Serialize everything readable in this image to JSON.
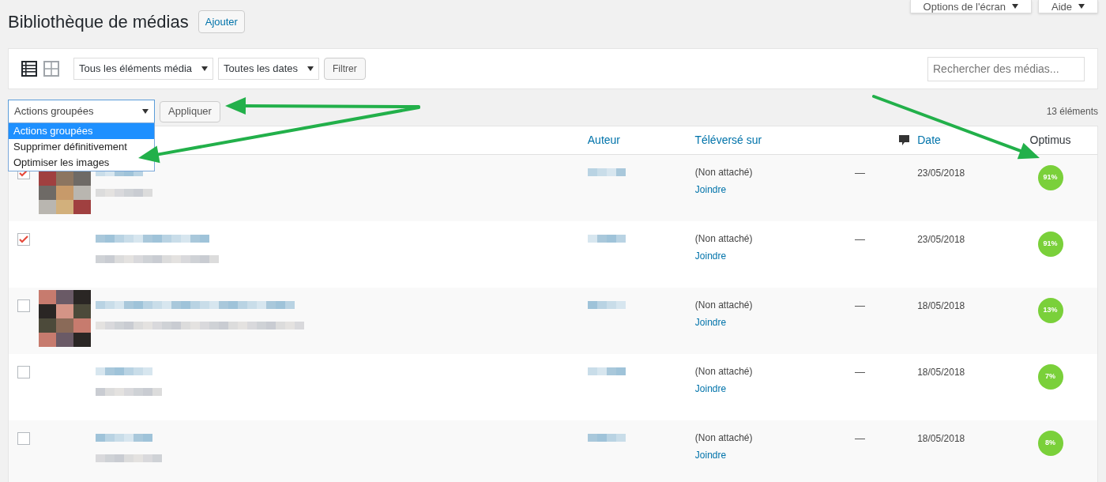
{
  "screen_options": [
    {
      "label": "Options de l'écran"
    },
    {
      "label": "Aide"
    }
  ],
  "page_title": "Bibliothèque de médias",
  "add_button": "Ajouter",
  "view_modes": [
    {
      "kind": "list",
      "selected": true
    },
    {
      "kind": "grid",
      "selected": false
    }
  ],
  "filters": [
    {
      "value": "Tous les éléments média"
    },
    {
      "value": "Toutes les dates"
    }
  ],
  "filter_button": "Filtrer",
  "search": {
    "placeholder": "Rechercher des médias..."
  },
  "bulk_actions": {
    "value": "Actions groupées",
    "expanded": true,
    "options": [
      {
        "label": "Actions groupées",
        "selected": true
      },
      {
        "label": "Supprimer définitivement",
        "selected": false
      },
      {
        "label": "Optimiser les images",
        "selected": false
      }
    ]
  },
  "apply_button": "Appliquer",
  "item_count": "13 éléments",
  "table": {
    "columns": [
      {
        "kind": "link",
        "label": "Auteur"
      },
      {
        "kind": "link",
        "label": "Téléversé sur"
      },
      {
        "kind": "comment"
      },
      {
        "kind": "link",
        "label": "Date"
      },
      {
        "kind": "plain",
        "label": "Optimus"
      }
    ],
    "rows": [
      {
        "checked": true,
        "attached": "(Non attaché)",
        "action": "Joindre",
        "comments": "—",
        "date": "23/05/2018",
        "optimus": "91%"
      },
      {
        "checked": true,
        "attached": "(Non attaché)",
        "action": "Joindre",
        "comments": "—",
        "date": "23/05/2018",
        "optimus": "91%"
      },
      {
        "checked": false,
        "attached": "(Non attaché)",
        "action": "Joindre",
        "comments": "—",
        "date": "18/05/2018",
        "optimus": "13%"
      },
      {
        "checked": false,
        "attached": "(Non attaché)",
        "action": "Joindre",
        "comments": "—",
        "date": "18/05/2018",
        "optimus": "7%"
      },
      {
        "checked": false,
        "attached": "(Non attaché)",
        "action": "Joindre",
        "comments": "—",
        "date": "18/05/2018",
        "optimus": "8%"
      }
    ]
  }
}
